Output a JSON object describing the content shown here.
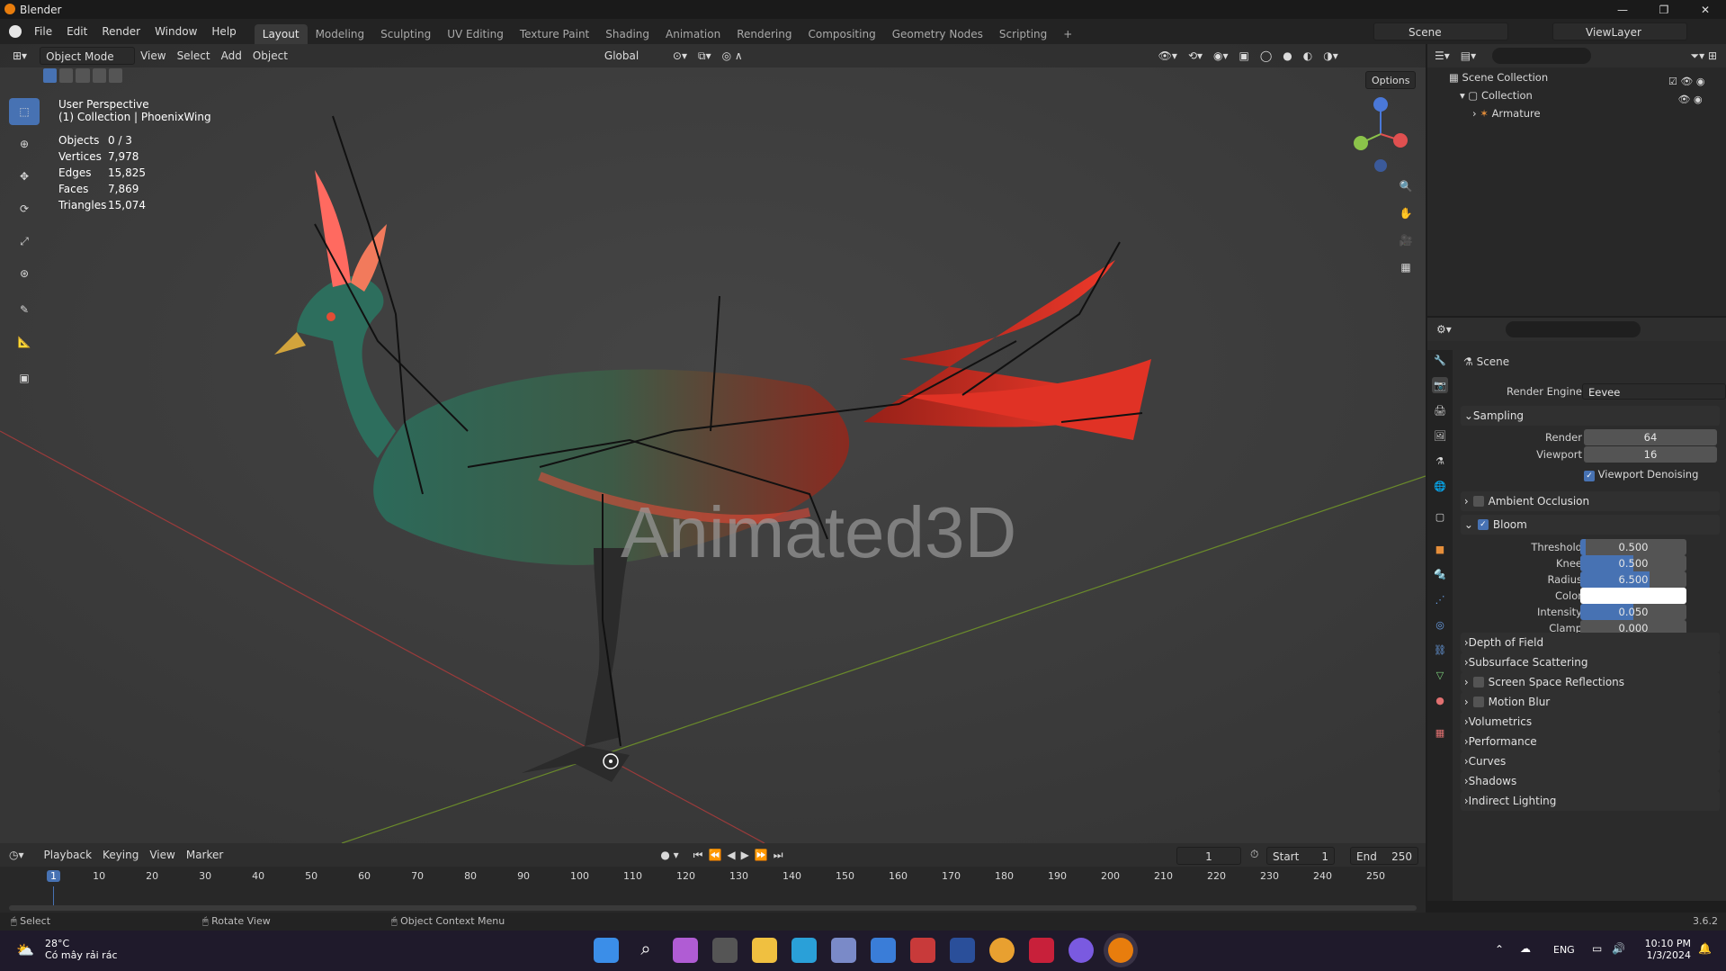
{
  "window": {
    "title": "Blender"
  },
  "menus": [
    "File",
    "Edit",
    "Render",
    "Window",
    "Help"
  ],
  "workspaces": [
    "Layout",
    "Modeling",
    "Sculpting",
    "UV Editing",
    "Texture Paint",
    "Shading",
    "Animation",
    "Rendering",
    "Compositing",
    "Geometry Nodes",
    "Scripting"
  ],
  "active_workspace": "Layout",
  "scene_field": "Scene",
  "view_layer_field": "ViewLayer",
  "viewport_header": {
    "mode": "Object Mode",
    "menus": [
      "View",
      "Select",
      "Add",
      "Object"
    ],
    "transform": "Global",
    "options": "Options"
  },
  "viewport_info": {
    "line1": "User Perspective",
    "line2": "(1) Collection | PhoenixWing"
  },
  "stats": [
    {
      "k": "Objects",
      "v": "0 / 3"
    },
    {
      "k": "Vertices",
      "v": "7,978"
    },
    {
      "k": "Edges",
      "v": "15,825"
    },
    {
      "k": "Faces",
      "v": "7,869"
    },
    {
      "k": "Triangles",
      "v": "15,074"
    }
  ],
  "watermark": "Animated3D",
  "outliner": {
    "root": "Scene Collection",
    "items": [
      {
        "label": "Collection"
      },
      {
        "label": "Armature"
      }
    ]
  },
  "properties": {
    "header": "Scene",
    "render_engine_label": "Render Engine",
    "render_engine": "Eevee",
    "sampling": {
      "title": "Sampling",
      "render_label": "Render",
      "render": "64",
      "viewport_label": "Viewport",
      "viewport": "16",
      "denoise": "Viewport Denoising"
    },
    "ambient_occlusion": "Ambient Occlusion",
    "bloom": {
      "title": "Bloom",
      "fields": [
        {
          "label": "Threshold",
          "value": "0.500",
          "fill": 0.05
        },
        {
          "label": "Knee",
          "value": "0.500",
          "fill": 0.5
        },
        {
          "label": "Radius",
          "value": "6.500",
          "fill": 0.65
        },
        {
          "label": "Color",
          "value": "",
          "fill": 0
        },
        {
          "label": "Intensity",
          "value": "0.050",
          "fill": 0.5
        },
        {
          "label": "Clamp",
          "value": "0.000",
          "fill": 0
        }
      ]
    },
    "sections": [
      "Depth of Field",
      "Subsurface Scattering",
      "Screen Space Reflections",
      "Motion Blur",
      "Volumetrics",
      "Performance",
      "Curves",
      "Shadows",
      "Indirect Lighting"
    ]
  },
  "timeline": {
    "menus": [
      "Playback",
      "Keying",
      "View",
      "Marker"
    ],
    "current_frame": "1",
    "start_label": "Start",
    "start": "1",
    "end_label": "End",
    "end": "250",
    "ticks": [
      "1",
      "10",
      "20",
      "30",
      "40",
      "50",
      "60",
      "70",
      "80",
      "90",
      "100",
      "110",
      "120",
      "130",
      "140",
      "150",
      "160",
      "170",
      "180",
      "190",
      "200",
      "210",
      "220",
      "230",
      "240",
      "250"
    ]
  },
  "status": {
    "select": "Select",
    "rotate": "Rotate View",
    "context": "Object Context Menu",
    "version": "3.6.2"
  },
  "taskbar": {
    "weather_temp": "28°C",
    "weather_desc": "Có mây rải rác",
    "lang": "ENG",
    "time": "10:10 PM",
    "date": "1/3/2024"
  }
}
